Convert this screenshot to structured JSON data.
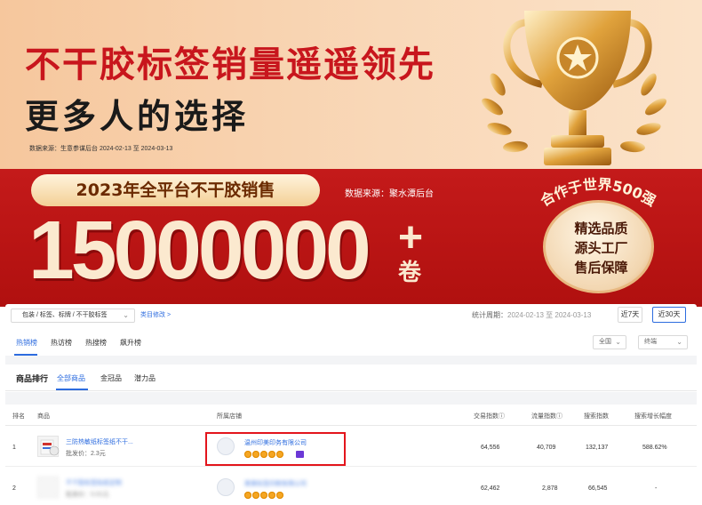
{
  "banner": {
    "headline_red": "不干胶标签销量遥遥领先",
    "headline_black": "更多人的选择",
    "source_note": "数据来源：生意参谋后台 2024-02-13 至 2024-03-13"
  },
  "sales_banner": {
    "pill_text": "2023年全平台不干胶销售",
    "source_note": "数据来源：聚水潭后台",
    "big_number": "15000000",
    "plus": "+",
    "unit": "卷"
  },
  "badge": {
    "arc_text": "合作于世界500强",
    "lines": [
      "精选品质",
      "源头工厂",
      "售后保障"
    ]
  },
  "toolbar": {
    "category_path": "包装 / 标签、标牌 / 不干胶标签",
    "category_edit": "类目修改 >",
    "period_label": "统计周期：",
    "period_dates": "2024-02-13 至 2024-03-13",
    "btn_7d": "近7天",
    "btn_30d": "近30天"
  },
  "tabs": [
    "热销榜",
    "热访榜",
    "热搜榜",
    "飙升榜"
  ],
  "filters": {
    "scope": "全国",
    "trend": "终端"
  },
  "ranking": {
    "title": "商品排行",
    "subtabs": [
      "全部商品",
      "金冠品",
      "潜力品"
    ]
  },
  "table": {
    "headers": [
      "排名",
      "商品",
      "所属店铺",
      "交易指数ⓘ",
      "流量指数ⓘ",
      "搜索指数",
      "搜索增长幅度"
    ],
    "rows": [
      {
        "rank": "1",
        "product": "三防热敏纸标签纸不干...",
        "price": "批发价：2.3元",
        "shop": "温州印美印务有限公司",
        "trade_index": "64,556",
        "traffic_index": "40,709",
        "search_index": "132,137",
        "search_growth": "588.62%"
      },
      {
        "rank": "2",
        "product": "不干胶标签贴纸定制",
        "price": "批发价：0.01元",
        "shop": "某某标签印刷有限公司",
        "trade_index": "62,462",
        "traffic_index": "2,878",
        "search_index": "66,545",
        "search_growth": "-"
      }
    ]
  },
  "colors": {
    "brand_red": "#c8161d",
    "link_blue": "#2d6cdf",
    "highlight": "#e3151c"
  }
}
